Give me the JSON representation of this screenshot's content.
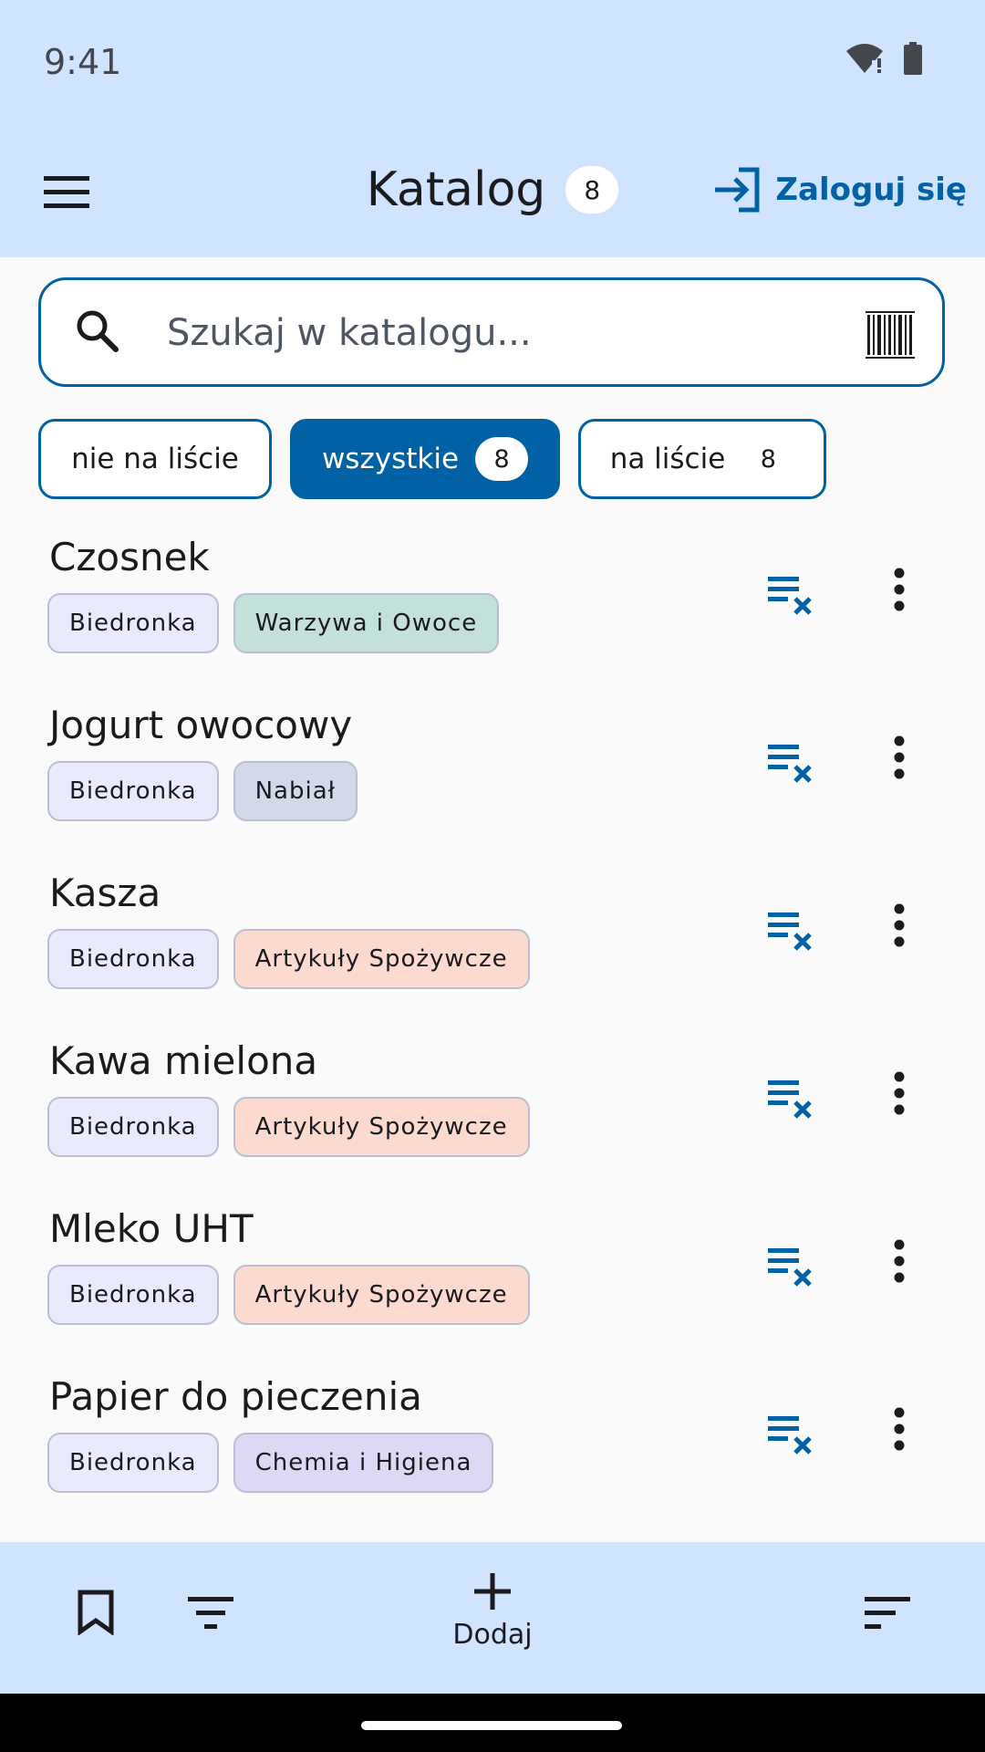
{
  "status": {
    "time": "9:41"
  },
  "appbar": {
    "title": "Katalog",
    "count": "8",
    "login_label": "Zaloguj się"
  },
  "search": {
    "placeholder": "Szukaj w katalogu..."
  },
  "filters": [
    {
      "label": "nie na liście",
      "count": ""
    },
    {
      "label": "wszystkie",
      "count": "8",
      "selected": true
    },
    {
      "label": "na liście",
      "count": "8"
    }
  ],
  "items": [
    {
      "name": "Czosnek",
      "shop": "Biedronka",
      "category": "Warzywa i Owoce",
      "category_color": "#c3e1da"
    },
    {
      "name": "Jogurt owocowy",
      "shop": "Biedronka",
      "category": "Nabiał",
      "category_color": "#d2d9e8"
    },
    {
      "name": "Kasza",
      "shop": "Biedronka",
      "category": "Artykuły Spożywcze",
      "category_color": "#fddad0"
    },
    {
      "name": "Kawa mielona",
      "shop": "Biedronka",
      "category": "Artykuły Spożywcze",
      "category_color": "#fddad0"
    },
    {
      "name": "Mleko UHT",
      "shop": "Biedronka",
      "category": "Artykuły Spożywcze",
      "category_color": "#fddad0"
    },
    {
      "name": "Papier do pieczenia",
      "shop": "Biedronka",
      "category": "Chemia i Higiena",
      "category_color": "#ddd9f5"
    }
  ],
  "bottom": {
    "add_label": "Dodaj"
  },
  "colors": {
    "primary": "#0061a4",
    "bar": "#d1e4ff",
    "background": "#fafafa"
  }
}
